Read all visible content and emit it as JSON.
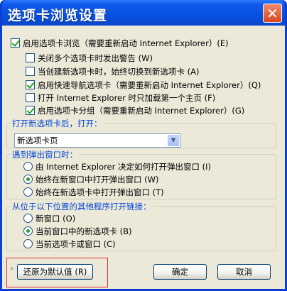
{
  "window": {
    "title": "选项卡浏览设置",
    "close_glyph": "✕"
  },
  "main_option": {
    "label": "启用选项卡浏览（需要重新启动 Internet Explorer）(E)",
    "checked": true
  },
  "sub_options": [
    {
      "label": "关闭多个选项卡时发出警告 (W)",
      "checked": false
    },
    {
      "label": "当创建新选项卡时，始终切换到新选项卡 (A)",
      "checked": false
    },
    {
      "label": "启用快速导航选项卡（需要重新启动 Internet Explorer）(Q)",
      "checked": true
    },
    {
      "label": "打开 Internet Explorer 时只加载第一个主页 (F)",
      "checked": false
    },
    {
      "label": "启用选项卡分组（需要重新启动 Internet Explorer）(G)",
      "checked": true
    }
  ],
  "group_new_tab": {
    "label": "打开新选项卡后，打开：",
    "selected_value": "新选项卡页"
  },
  "group_popup": {
    "label": "遇到弹出窗口时：",
    "options": [
      {
        "label": "由 Internet Explorer 决定如何打开弹出窗口 (I)",
        "checked": false
      },
      {
        "label": "始终在新窗口中打开弹出窗口 (W)",
        "checked": true
      },
      {
        "label": "始终在新选项卡中打开弹出窗口 (T)",
        "checked": false
      }
    ]
  },
  "group_links": {
    "label": "从位于以下位置的其他程序打开链接：",
    "options": [
      {
        "label": "新窗口 (O)",
        "checked": false
      },
      {
        "label": "当前窗口中的新选项卡 (B)",
        "checked": true
      },
      {
        "label": "当前选项卡或窗口 (C)",
        "checked": false
      }
    ]
  },
  "buttons": {
    "restore_label": "还原为默认值 (R)",
    "ok_label": "确定",
    "cancel_label": "取消"
  },
  "footnote_mark": "*",
  "colors": {
    "titlebar": "#0651e0",
    "group_label": "#0046d5",
    "check_mark": "#21a121",
    "highlight_frame": "#dd3333"
  }
}
